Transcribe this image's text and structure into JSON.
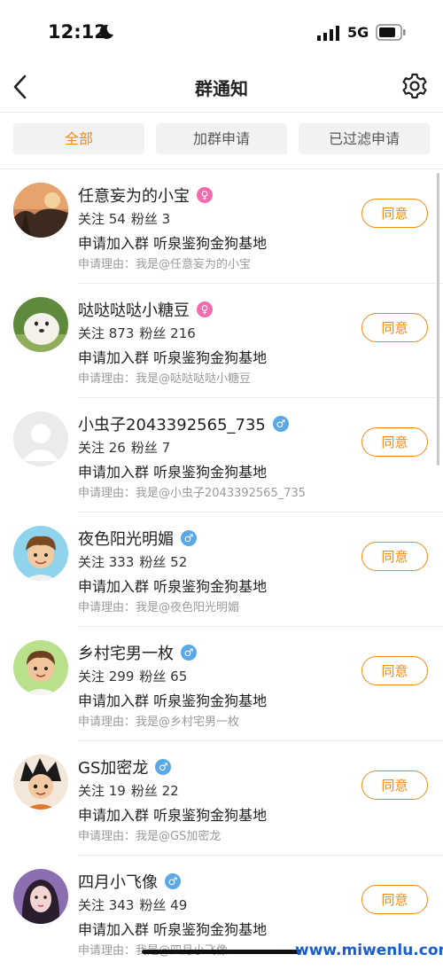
{
  "status_bar": {
    "time": "12:12",
    "network": "5G"
  },
  "header": {
    "title": "群通知"
  },
  "tabs": [
    {
      "label": "全部",
      "active": true
    },
    {
      "label": "加群申请",
      "active": false
    },
    {
      "label": "已过滤申请",
      "active": false
    }
  ],
  "colors": {
    "accent": "#f08a18",
    "female": "#f06cae",
    "male": "#5aa9e6"
  },
  "items": [
    {
      "name": "任意妄为的小宝",
      "gender": "female",
      "following": "关注 54",
      "followers": "粉丝 3",
      "request": "申请加入群 听泉鉴狗金狗基地",
      "reason": "申请理由：我是@任意妄为的小宝",
      "button": "同意"
    },
    {
      "name": "哒哒哒哒小糖豆",
      "gender": "female",
      "following": "关注 873",
      "followers": "粉丝 216",
      "request": "申请加入群 听泉鉴狗金狗基地",
      "reason": "申请理由：我是@哒哒哒哒小糖豆",
      "button": "同意"
    },
    {
      "name": "小虫子2043392565_735",
      "gender": "male",
      "following": "关注 26",
      "followers": "粉丝 7",
      "request": "申请加入群 听泉鉴狗金狗基地",
      "reason": "申请理由：我是@小虫子2043392565_735",
      "button": "同意"
    },
    {
      "name": "夜色阳光明媚",
      "gender": "male",
      "following": "关注 333",
      "followers": "粉丝 52",
      "request": "申请加入群 听泉鉴狗金狗基地",
      "reason": "申请理由：我是@夜色阳光明媚",
      "button": "同意"
    },
    {
      "name": "乡村宅男一枚",
      "gender": "male",
      "following": "关注 299",
      "followers": "粉丝 65",
      "request": "申请加入群 听泉鉴狗金狗基地",
      "reason": "申请理由：我是@乡村宅男一枚",
      "button": "同意"
    },
    {
      "name": "GS加密龙",
      "gender": "male",
      "following": "关注 19",
      "followers": "粉丝 22",
      "request": "申请加入群 听泉鉴狗金狗基地",
      "reason": "申请理由：我是@GS加密龙",
      "button": "同意"
    },
    {
      "name": "四月小飞像",
      "gender": "male",
      "following": "关注 343",
      "followers": "粉丝 49",
      "request": "申请加入群 听泉鉴狗金狗基地",
      "reason": "申请理由：我是@四月小飞像",
      "button": "同意"
    }
  ],
  "watermark": "www.miwenlu.com"
}
